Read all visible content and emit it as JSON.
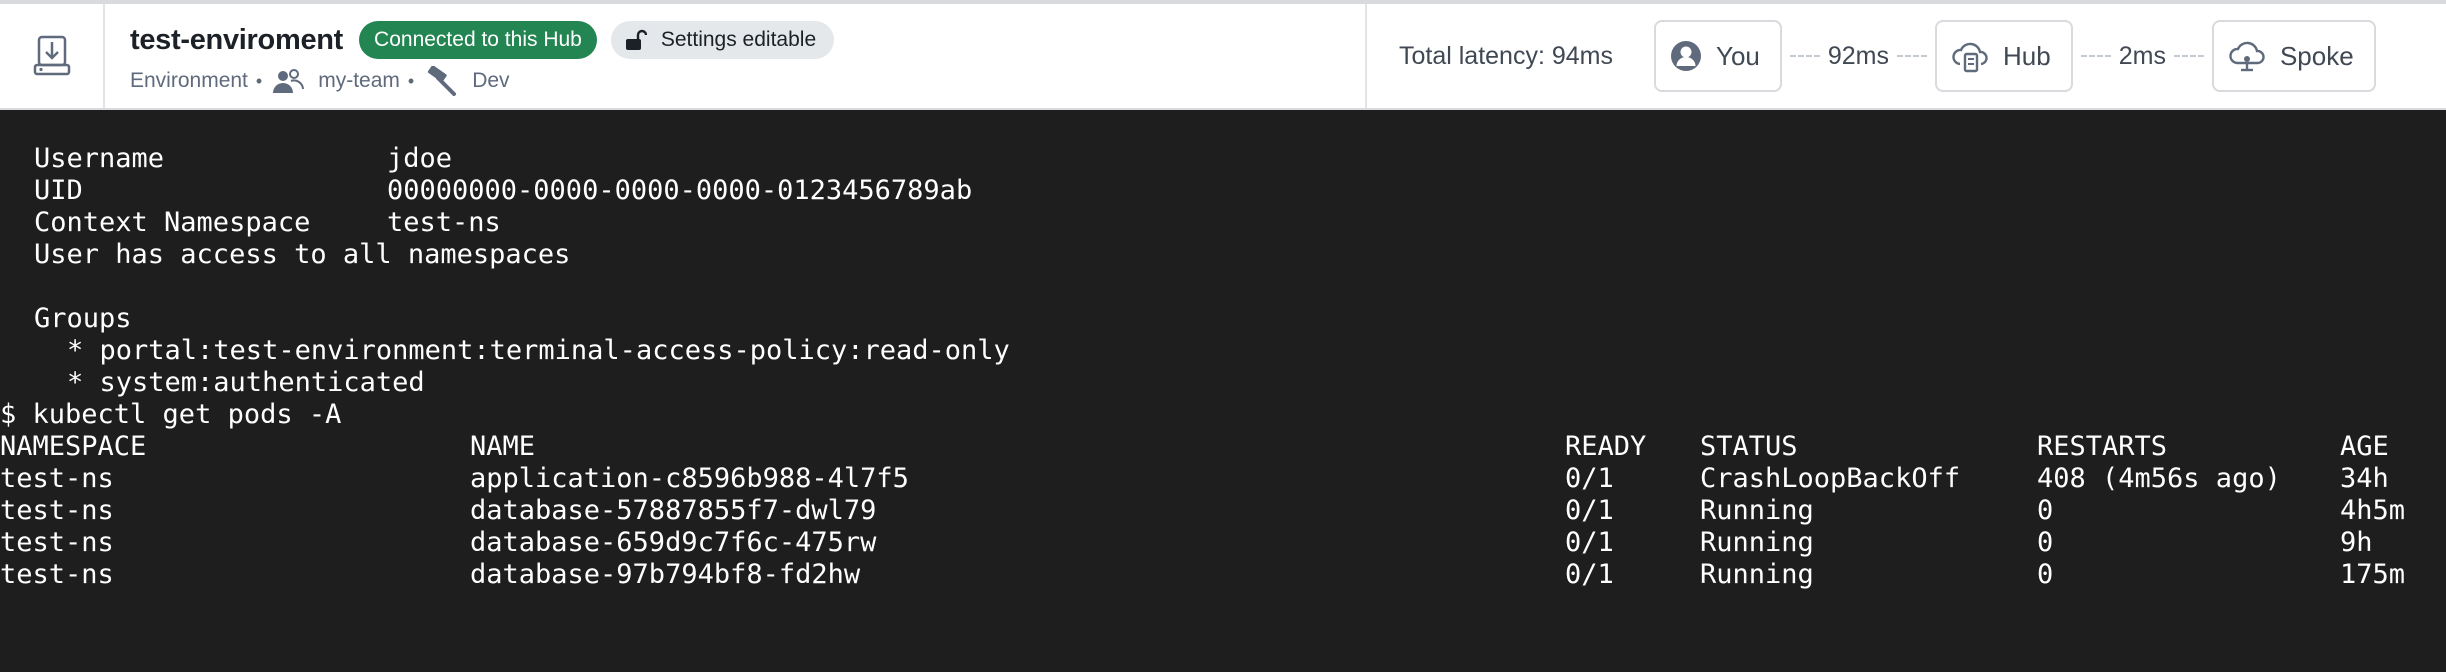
{
  "header": {
    "environment_name": "test-enviroment",
    "connected_badge": "Connected to this Hub",
    "settings_badge": "Settings editable",
    "type_label": "Environment",
    "team": "my-team",
    "stage": "Dev",
    "icons": {
      "home": "server-upload-icon",
      "lock": "unlock-icon",
      "team": "people-icon",
      "stage": "hammer-icon"
    }
  },
  "latency": {
    "total": "Total latency: 94ms",
    "you_label": "You",
    "you_to_hub": "92ms",
    "hub_label": "Hub",
    "hub_to_spoke": "2ms",
    "spoke_label": "Spoke"
  },
  "terminal": {
    "whoami": [
      {
        "key": "Username",
        "value": "jdoe"
      },
      {
        "key": "UID",
        "value": "00000000-0000-0000-0000-0123456789ab"
      },
      {
        "key": "Context Namespace",
        "value": "test-ns"
      }
    ],
    "access_note": "User has access to all namespaces",
    "groups_label": "Groups",
    "groups": [
      "* portal:test-environment:terminal-access-policy:read-only",
      "* system:authenticated"
    ],
    "command": "$ kubectl get pods -A",
    "columns": [
      "NAMESPACE",
      "NAME",
      "READY",
      "STATUS",
      "RESTARTS",
      "AGE"
    ],
    "pods": [
      [
        "test-ns",
        "application-c8596b988-4l7f5",
        "0/1",
        "CrashLoopBackOff",
        "408 (4m56s ago)",
        "34h"
      ],
      [
        "test-ns",
        "database-57887855f7-dwl79",
        "0/1",
        "Running",
        "0",
        "4h5m"
      ],
      [
        "test-ns",
        "database-659d9c7f6c-475rw",
        "0/1",
        "Running",
        "0",
        "9h"
      ],
      [
        "test-ns",
        "database-97b794bf8-fd2hw",
        "0/1",
        "Running",
        "0",
        "175m"
      ]
    ]
  },
  "colors": {
    "connected": "#238551",
    "terminal_bg": "#1e1e1e"
  }
}
